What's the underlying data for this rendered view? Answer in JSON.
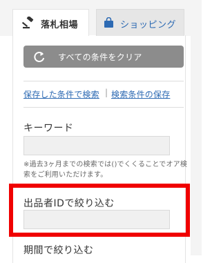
{
  "tabs": {
    "auction": {
      "label": "落札相場",
      "icon": "gavel-icon",
      "active": true
    },
    "shopping": {
      "label": "ショッピング",
      "icon": "shopping-bag-icon",
      "active": false
    }
  },
  "clear_button": {
    "label": "すべての条件をクリア",
    "icon": "refresh-icon"
  },
  "links": {
    "saved_search": "保存した条件で検索",
    "separator": "|",
    "save_conditions": "検索条件の保存"
  },
  "keyword": {
    "title": "キーワード",
    "value": "",
    "note": "※過去3ヶ月までの検索では()でくくることでオア検索をご利用いただけます。"
  },
  "seller_id": {
    "title": "出品者IDで絞り込む",
    "value": ""
  },
  "period": {
    "title": "期間で絞り込む"
  },
  "colors": {
    "accent_blue": "#2d6ab3",
    "button_gray": "#8c8c8c",
    "highlight_red": "#f00000"
  }
}
